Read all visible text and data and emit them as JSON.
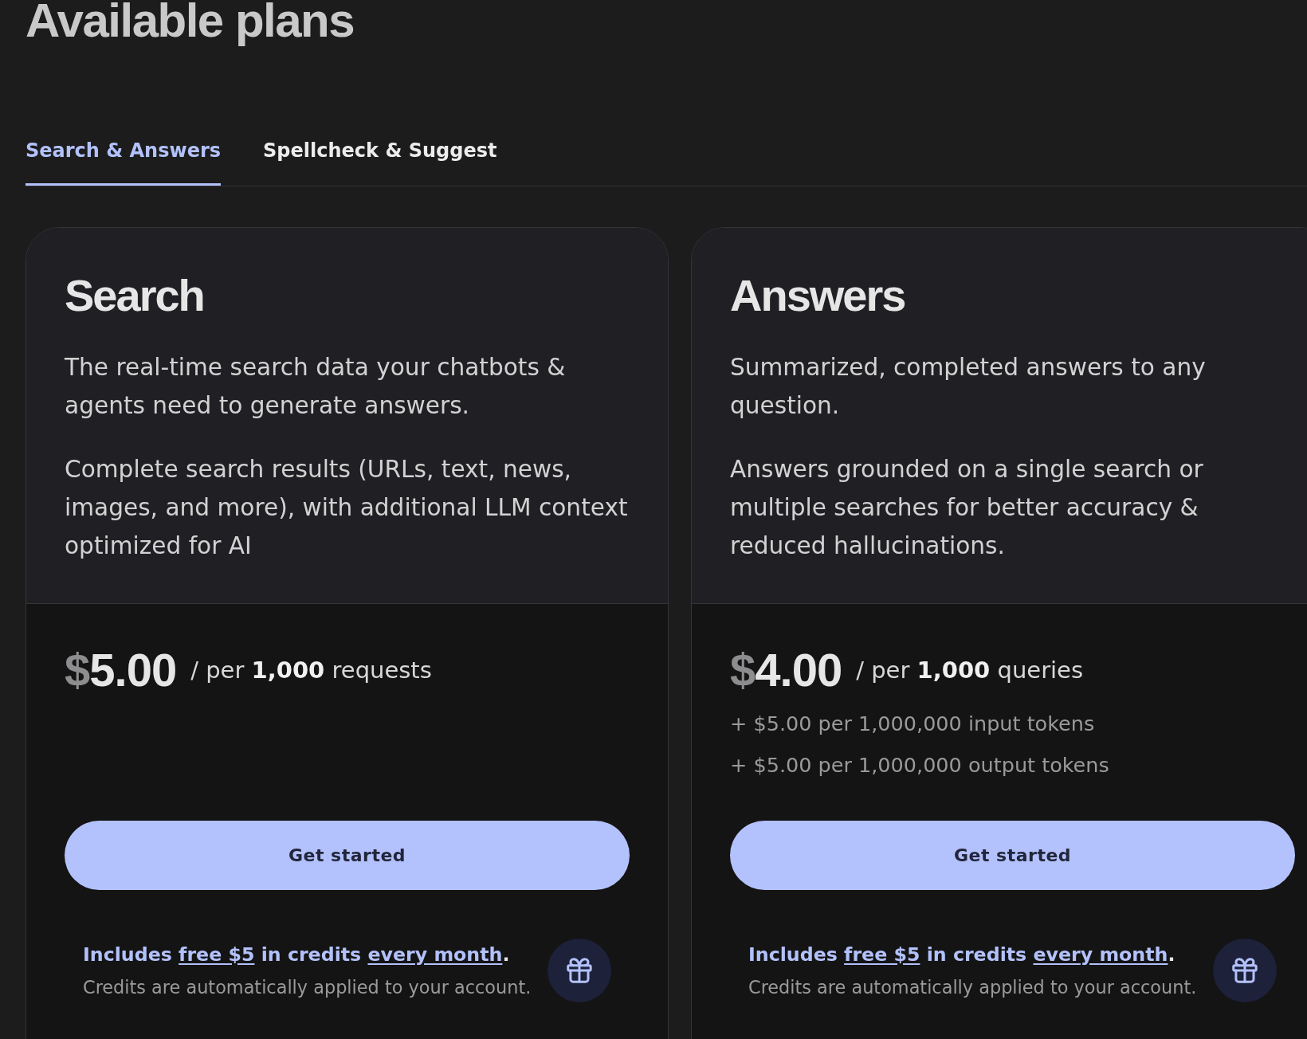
{
  "heading": "Available plans",
  "tabs": [
    {
      "label": "Search & Answers",
      "selected": true
    },
    {
      "label": "Spellcheck & Suggest",
      "selected": false
    }
  ],
  "plans": [
    {
      "title": "Search",
      "description": [
        "The real-time search data your chatbots & agents need to generate answers.",
        "Complete search results (URLs, text, news, images, and more), with additional LLM context optimized for AI"
      ],
      "price": {
        "currency": "$",
        "amount": "5.00",
        "unit": "/ per **1,000** requests"
      },
      "button": "Get started",
      "note": [
        {
          "kind": "text",
          "text": "Includes "
        },
        {
          "kind": "link",
          "text": "free $5"
        },
        {
          "kind": "text",
          "text": " in credits "
        },
        {
          "kind": "link",
          "text": "every month"
        },
        {
          "kind": "plain",
          "text": "."
        }
      ],
      "subnote": "Credits are automatically applied to your account."
    },
    {
      "title": "Answers",
      "description": [
        "Summarized, completed answers to any question.",
        "Answers grounded on a single search or multiple searches for better accuracy & reduced hallucinations."
      ],
      "price": {
        "currency": "$",
        "amount": "4.00",
        "unit": "/ per **1,000** queries"
      },
      "extras": [
        "+ $5.00 per 1,000,000 input tokens",
        "+ $5.00 per 1,000,000 output tokens"
      ],
      "button": "Get started",
      "note": [
        {
          "kind": "text",
          "text": "Includes "
        },
        {
          "kind": "link",
          "text": "free $5"
        },
        {
          "kind": "text",
          "text": " in credits "
        },
        {
          "kind": "link",
          "text": "every month"
        },
        {
          "kind": "plain",
          "text": "."
        }
      ],
      "subnote": "Credits are automatically applied to your account."
    }
  ]
}
